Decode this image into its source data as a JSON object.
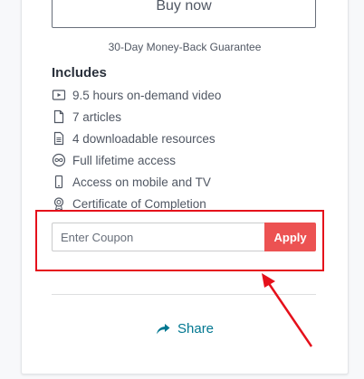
{
  "purchase": {
    "buy_label": "Buy now",
    "guarantee": "30-Day Money-Back Guarantee"
  },
  "includes": {
    "title": "Includes",
    "items": [
      {
        "label": "9.5 hours on-demand video",
        "icon": "video-icon"
      },
      {
        "label": "7 articles",
        "icon": "article-icon"
      },
      {
        "label": "4 downloadable resources",
        "icon": "download-icon"
      },
      {
        "label": "Full lifetime access",
        "icon": "infinity-icon"
      },
      {
        "label": "Access on mobile and TV",
        "icon": "mobile-icon"
      },
      {
        "label": "Certificate of Completion",
        "icon": "certificate-icon"
      }
    ]
  },
  "coupon": {
    "placeholder": "Enter Coupon",
    "apply_label": "Apply"
  },
  "share": {
    "label": "Share"
  },
  "colors": {
    "apply": "#ec5252",
    "share": "#007791",
    "annotation": "#e5101b"
  }
}
